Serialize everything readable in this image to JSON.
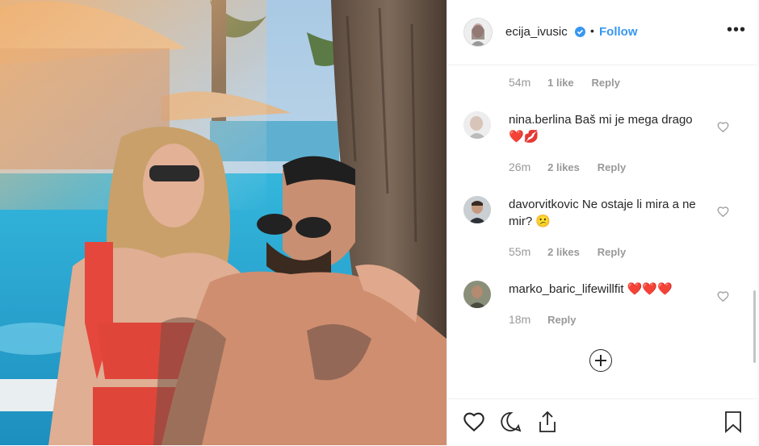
{
  "post": {
    "username": "ecija_ivusic",
    "dot": "•",
    "follow_label": "Follow",
    "more_label": "•••"
  },
  "first_meta": {
    "time": "54m",
    "likes": "1 like",
    "reply": "Reply"
  },
  "comments": [
    {
      "username": "nina.berlina",
      "text": "Baš mi je mega drago ❤️💋",
      "time": "26m",
      "likes": "2 likes",
      "reply": "Reply"
    },
    {
      "username": "davorvitkovic",
      "text": "Ne ostaje li mira a ne mir? 😕",
      "time": "55m",
      "likes": "2 likes",
      "reply": "Reply"
    },
    {
      "username": "marko_baric_lifewillfit",
      "text": "❤️❤️❤️",
      "time": "18m",
      "likes": "",
      "reply": "Reply"
    }
  ],
  "colors": {
    "link": "#3897f0",
    "muted": "#999999",
    "text": "#262626",
    "heart_red": "#e0161b"
  },
  "icons": [
    "heart-icon",
    "comment-icon",
    "share-icon",
    "bookmark-icon",
    "plus-circle-icon",
    "verified-badge-icon",
    "more-options-icon"
  ]
}
